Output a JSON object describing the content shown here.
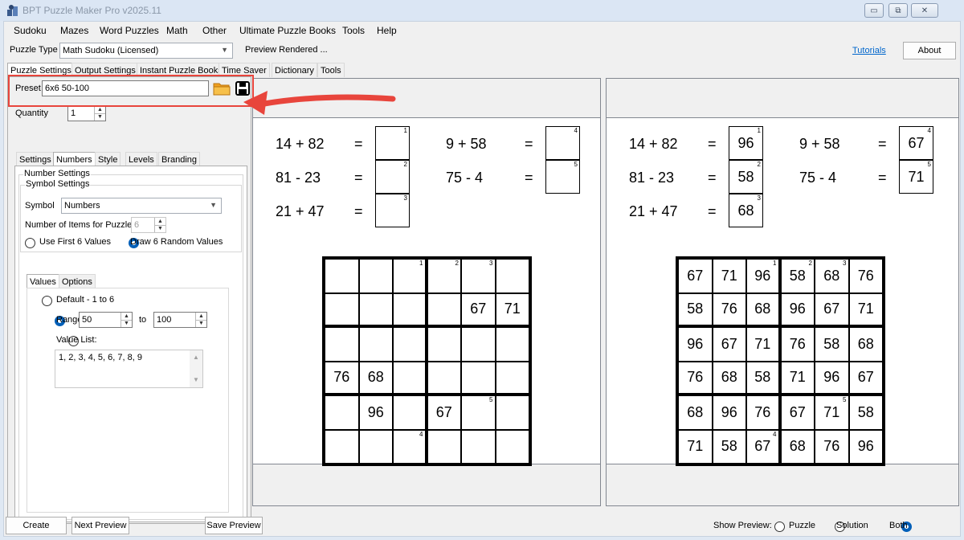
{
  "window": {
    "title": "BPT Puzzle Maker Pro v2025.11",
    "controls": [
      "▭",
      "⧉",
      "✕"
    ]
  },
  "menu": [
    "Sudoku",
    "Mazes",
    "Word Puzzles",
    "Math",
    "Other",
    "Ultimate Puzzle Books",
    "Tools",
    "Help"
  ],
  "toolbar": {
    "puzzle_type_label": "Puzzle Type",
    "puzzle_type_value": "Math Sudoku (Licensed)",
    "status": "Preview Rendered ...",
    "tutorials": "Tutorials",
    "about": "About"
  },
  "main_tabs": [
    "Puzzle Settings",
    "Output Settings",
    "Instant Puzzle Books",
    "Time Saver",
    "Dictionary",
    "Tools"
  ],
  "preset": {
    "label": "Preset",
    "value": "6x6 50-100"
  },
  "quantity": {
    "label": "Quantity",
    "value": "1"
  },
  "sub_tabs": [
    "Settings",
    "Numbers",
    "Style",
    "Levels",
    "Branding"
  ],
  "numbers": {
    "group_title": "Number Settings",
    "symbol_group": "Symbol Settings",
    "symbol_label": "Symbol",
    "symbol_value": "Numbers",
    "items_label": "Number of Items for Puzzle:",
    "items_value": "6",
    "use_first": "Use First 6 Values",
    "draw_random": "Draw 6 Random Values"
  },
  "values_tabs": [
    "Values",
    "Options"
  ],
  "values": {
    "default_label": "Default - 1 to 6",
    "range_label": "Range",
    "range_from": "50",
    "to_label": "to",
    "range_to": "100",
    "value_list_label": "Value List:",
    "value_list": "1, 2, 3, 4, 5, 6, 7, 8, 9"
  },
  "puzzle_preview": {
    "equations": [
      {
        "expr": "14 + 82",
        "eq": "=",
        "num": "1",
        "answer": ""
      },
      {
        "expr": "81 - 23",
        "eq": "=",
        "num": "2",
        "answer": ""
      },
      {
        "expr": "21 + 47",
        "eq": "=",
        "num": "3",
        "answer": ""
      },
      {
        "expr": "9 + 58",
        "eq": "=",
        "num": "4",
        "answer": ""
      },
      {
        "expr": "75 - 4",
        "eq": "=",
        "num": "5",
        "answer": ""
      }
    ],
    "grid": [
      [
        "",
        "",
        "",
        "",
        "",
        ""
      ],
      [
        "",
        "",
        "",
        "",
        "67",
        "71"
      ],
      [
        "",
        "",
        "",
        "",
        "",
        ""
      ],
      [
        "76",
        "68",
        "",
        "",
        "",
        ""
      ],
      [
        "",
        "96",
        "",
        "67",
        "",
        ""
      ],
      [
        "",
        "",
        "",
        "",
        "",
        ""
      ]
    ],
    "corner_numbers": [
      {
        "r": 0,
        "c": 2,
        "n": "1"
      },
      {
        "r": 0,
        "c": 3,
        "n": "2"
      },
      {
        "r": 0,
        "c": 4,
        "n": "3"
      },
      {
        "r": 4,
        "c": 4,
        "n": "5"
      },
      {
        "r": 5,
        "c": 2,
        "n": "4"
      }
    ]
  },
  "solution_preview": {
    "equations": [
      {
        "expr": "14 + 82",
        "eq": "=",
        "num": "1",
        "answer": "96"
      },
      {
        "expr": "81 - 23",
        "eq": "=",
        "num": "2",
        "answer": "58"
      },
      {
        "expr": "21 + 47",
        "eq": "=",
        "num": "3",
        "answer": "68"
      },
      {
        "expr": "9 + 58",
        "eq": "=",
        "num": "4",
        "answer": "67"
      },
      {
        "expr": "75 - 4",
        "eq": "=",
        "num": "5",
        "answer": "71"
      }
    ],
    "grid": [
      [
        "67",
        "71",
        "96",
        "58",
        "68",
        "76"
      ],
      [
        "58",
        "76",
        "68",
        "96",
        "67",
        "71"
      ],
      [
        "96",
        "67",
        "71",
        "76",
        "58",
        "68"
      ],
      [
        "76",
        "68",
        "58",
        "71",
        "96",
        "67"
      ],
      [
        "68",
        "96",
        "76",
        "67",
        "71",
        "58"
      ],
      [
        "71",
        "58",
        "67",
        "68",
        "76",
        "96"
      ]
    ],
    "corner_numbers": [
      {
        "r": 0,
        "c": 2,
        "n": "1"
      },
      {
        "r": 0,
        "c": 3,
        "n": "2"
      },
      {
        "r": 0,
        "c": 4,
        "n": "3"
      },
      {
        "r": 4,
        "c": 4,
        "n": "5"
      },
      {
        "r": 5,
        "c": 2,
        "n": "4"
      }
    ]
  },
  "bottom": {
    "create": "Create",
    "next_preview": "Next Preview",
    "save_preview": "Save Preview",
    "show_preview_label": "Show Preview:",
    "opt_puzzle": "Puzzle",
    "opt_solution": "Solution",
    "opt_both": "Both"
  },
  "colors": {
    "annotation_red": "#e8453c",
    "accent_blue": "#005fb8",
    "folder_orange": "#f0a020"
  }
}
